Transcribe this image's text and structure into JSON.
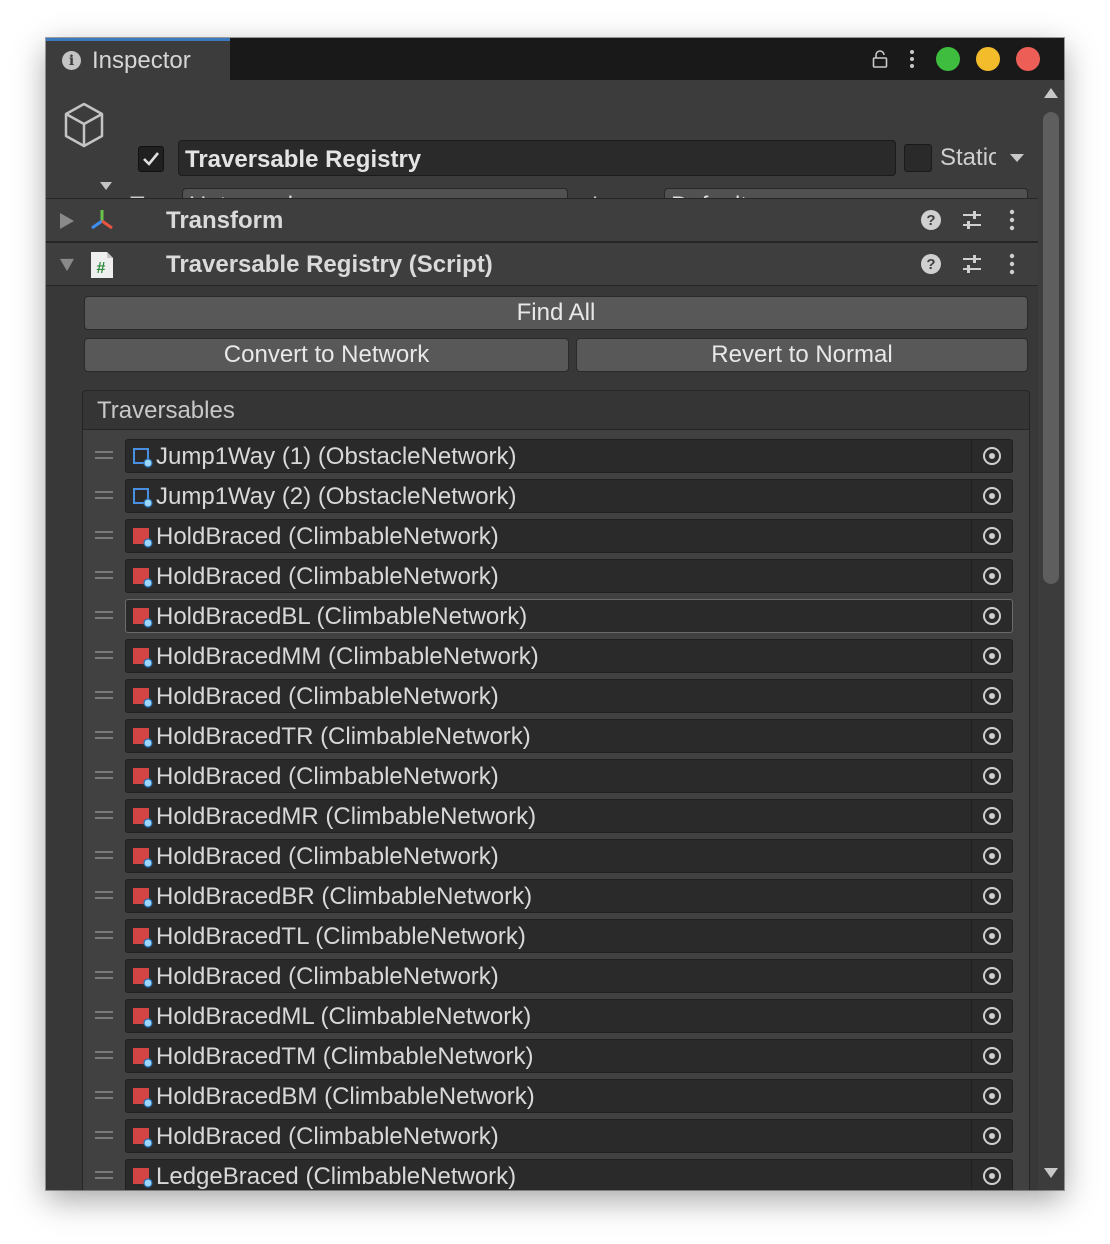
{
  "window": {
    "tab_title": "Inspector",
    "traffic_colors": {
      "close": "#ed5f56",
      "minimize": "#f3bc2b",
      "zoom": "#3ebd3e"
    },
    "accent": "#3a79bb"
  },
  "header": {
    "active": true,
    "object_name": "Traversable Registry",
    "static_label": "Static",
    "static_checked": false,
    "tag_label": "Tag",
    "tag_value": "Untagged",
    "layer_label": "Layer",
    "layer_value": "Default"
  },
  "components": [
    {
      "title": "Transform",
      "expanded": false,
      "icon": "transform-icon"
    },
    {
      "title": "Traversable Registry (Script)",
      "expanded": true,
      "icon": "script-icon"
    }
  ],
  "script": {
    "find_all_label": "Find All",
    "convert_label": "Convert to Network",
    "revert_label": "Revert to Normal",
    "list_label": "Traversables",
    "items": [
      {
        "label": "Jump1Way (1) (ObstacleNetwork)",
        "icon": "obstacle-icon"
      },
      {
        "label": "Jump1Way (2) (ObstacleNetwork)",
        "icon": "obstacle-icon"
      },
      {
        "label": "HoldBraced (ClimbableNetwork)",
        "icon": "climbable-icon"
      },
      {
        "label": "HoldBraced (ClimbableNetwork)",
        "icon": "climbable-icon"
      },
      {
        "label": "HoldBracedBL (ClimbableNetwork)",
        "icon": "climbable-icon",
        "selected": true
      },
      {
        "label": "HoldBracedMM (ClimbableNetwork)",
        "icon": "climbable-icon"
      },
      {
        "label": "HoldBraced (ClimbableNetwork)",
        "icon": "climbable-icon"
      },
      {
        "label": "HoldBracedTR (ClimbableNetwork)",
        "icon": "climbable-icon"
      },
      {
        "label": "HoldBraced (ClimbableNetwork)",
        "icon": "climbable-icon"
      },
      {
        "label": "HoldBracedMR (ClimbableNetwork)",
        "icon": "climbable-icon"
      },
      {
        "label": "HoldBraced (ClimbableNetwork)",
        "icon": "climbable-icon"
      },
      {
        "label": "HoldBracedBR (ClimbableNetwork)",
        "icon": "climbable-icon"
      },
      {
        "label": "HoldBracedTL (ClimbableNetwork)",
        "icon": "climbable-icon"
      },
      {
        "label": "HoldBraced (ClimbableNetwork)",
        "icon": "climbable-icon"
      },
      {
        "label": "HoldBracedML (ClimbableNetwork)",
        "icon": "climbable-icon"
      },
      {
        "label": "HoldBracedTM (ClimbableNetwork)",
        "icon": "climbable-icon"
      },
      {
        "label": "HoldBracedBM (ClimbableNetwork)",
        "icon": "climbable-icon"
      },
      {
        "label": "HoldBraced (ClimbableNetwork)",
        "icon": "climbable-icon"
      },
      {
        "label": "LedgeBraced (ClimbableNetwork)",
        "icon": "climbable-icon"
      }
    ]
  }
}
